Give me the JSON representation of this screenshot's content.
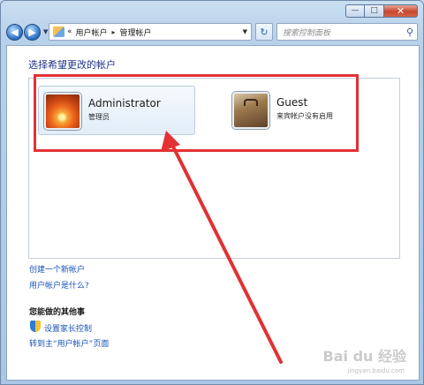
{
  "window": {
    "minimize_label": "—",
    "maximize_label": "□",
    "close_label": "✕"
  },
  "navbar": {
    "back_label": "◀",
    "forward_label": "▶",
    "history_dropdown": "▼",
    "address_prefix": "«",
    "breadcrumb": [
      "用户帐户",
      "管理帐户"
    ],
    "breadcrumb_separator": "▸",
    "address_dropdown": "▼",
    "refresh_label": "↻",
    "search_placeholder": "搜索控制面板",
    "search_icon_glyph": "⚲"
  },
  "main": {
    "heading": "选择希望更改的帐户",
    "accounts": [
      {
        "name": "Administrator",
        "role": "管理员",
        "avatar": "orange-flower-icon"
      },
      {
        "name": "Guest",
        "role": "来宾帐户没有启用",
        "avatar": "briefcase-icon"
      }
    ],
    "links": {
      "create_account": "创建一个新帐户",
      "what_is_account": "用户帐户是什么?"
    },
    "other_heading": "您能做的其他事",
    "other_links": {
      "parental_controls": "设置家长控制",
      "go_to_main": "转到主“用户帐户”页面"
    }
  },
  "watermark": {
    "text": "Bai du 经验",
    "sub": "jingyan.baidu.com"
  },
  "annotation": {
    "color": "#e33134"
  }
}
